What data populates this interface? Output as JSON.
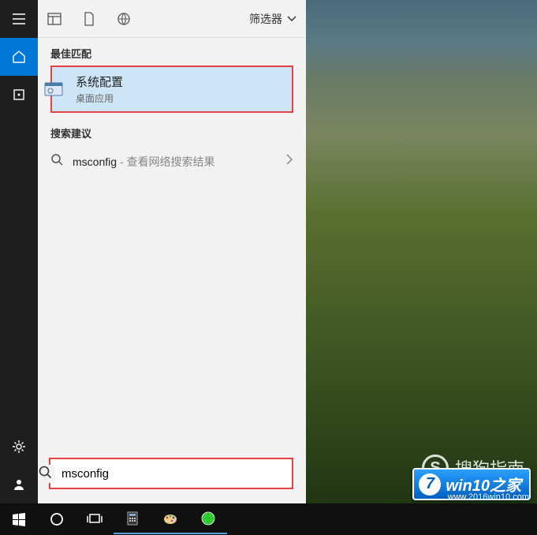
{
  "rail": {
    "menu": "menu",
    "home": "home",
    "recent": "recent",
    "settings": "settings",
    "user": "user"
  },
  "header": {
    "filter_label": "筛选器"
  },
  "sections": {
    "best_match": "最佳匹配",
    "suggestions": "搜索建议"
  },
  "best_match": {
    "title": "系统配置",
    "subtitle": "桌面应用"
  },
  "suggestion": {
    "term": "msconfig",
    "hint": " - 查看网络搜索结果"
  },
  "search": {
    "value": "msconfig",
    "placeholder": ""
  },
  "watermarks": {
    "sogou": "搜狗指南",
    "sogou_s": "S",
    "win10_7": "7",
    "win10_text": "win10之家",
    "url": "www.2016win10.com"
  }
}
